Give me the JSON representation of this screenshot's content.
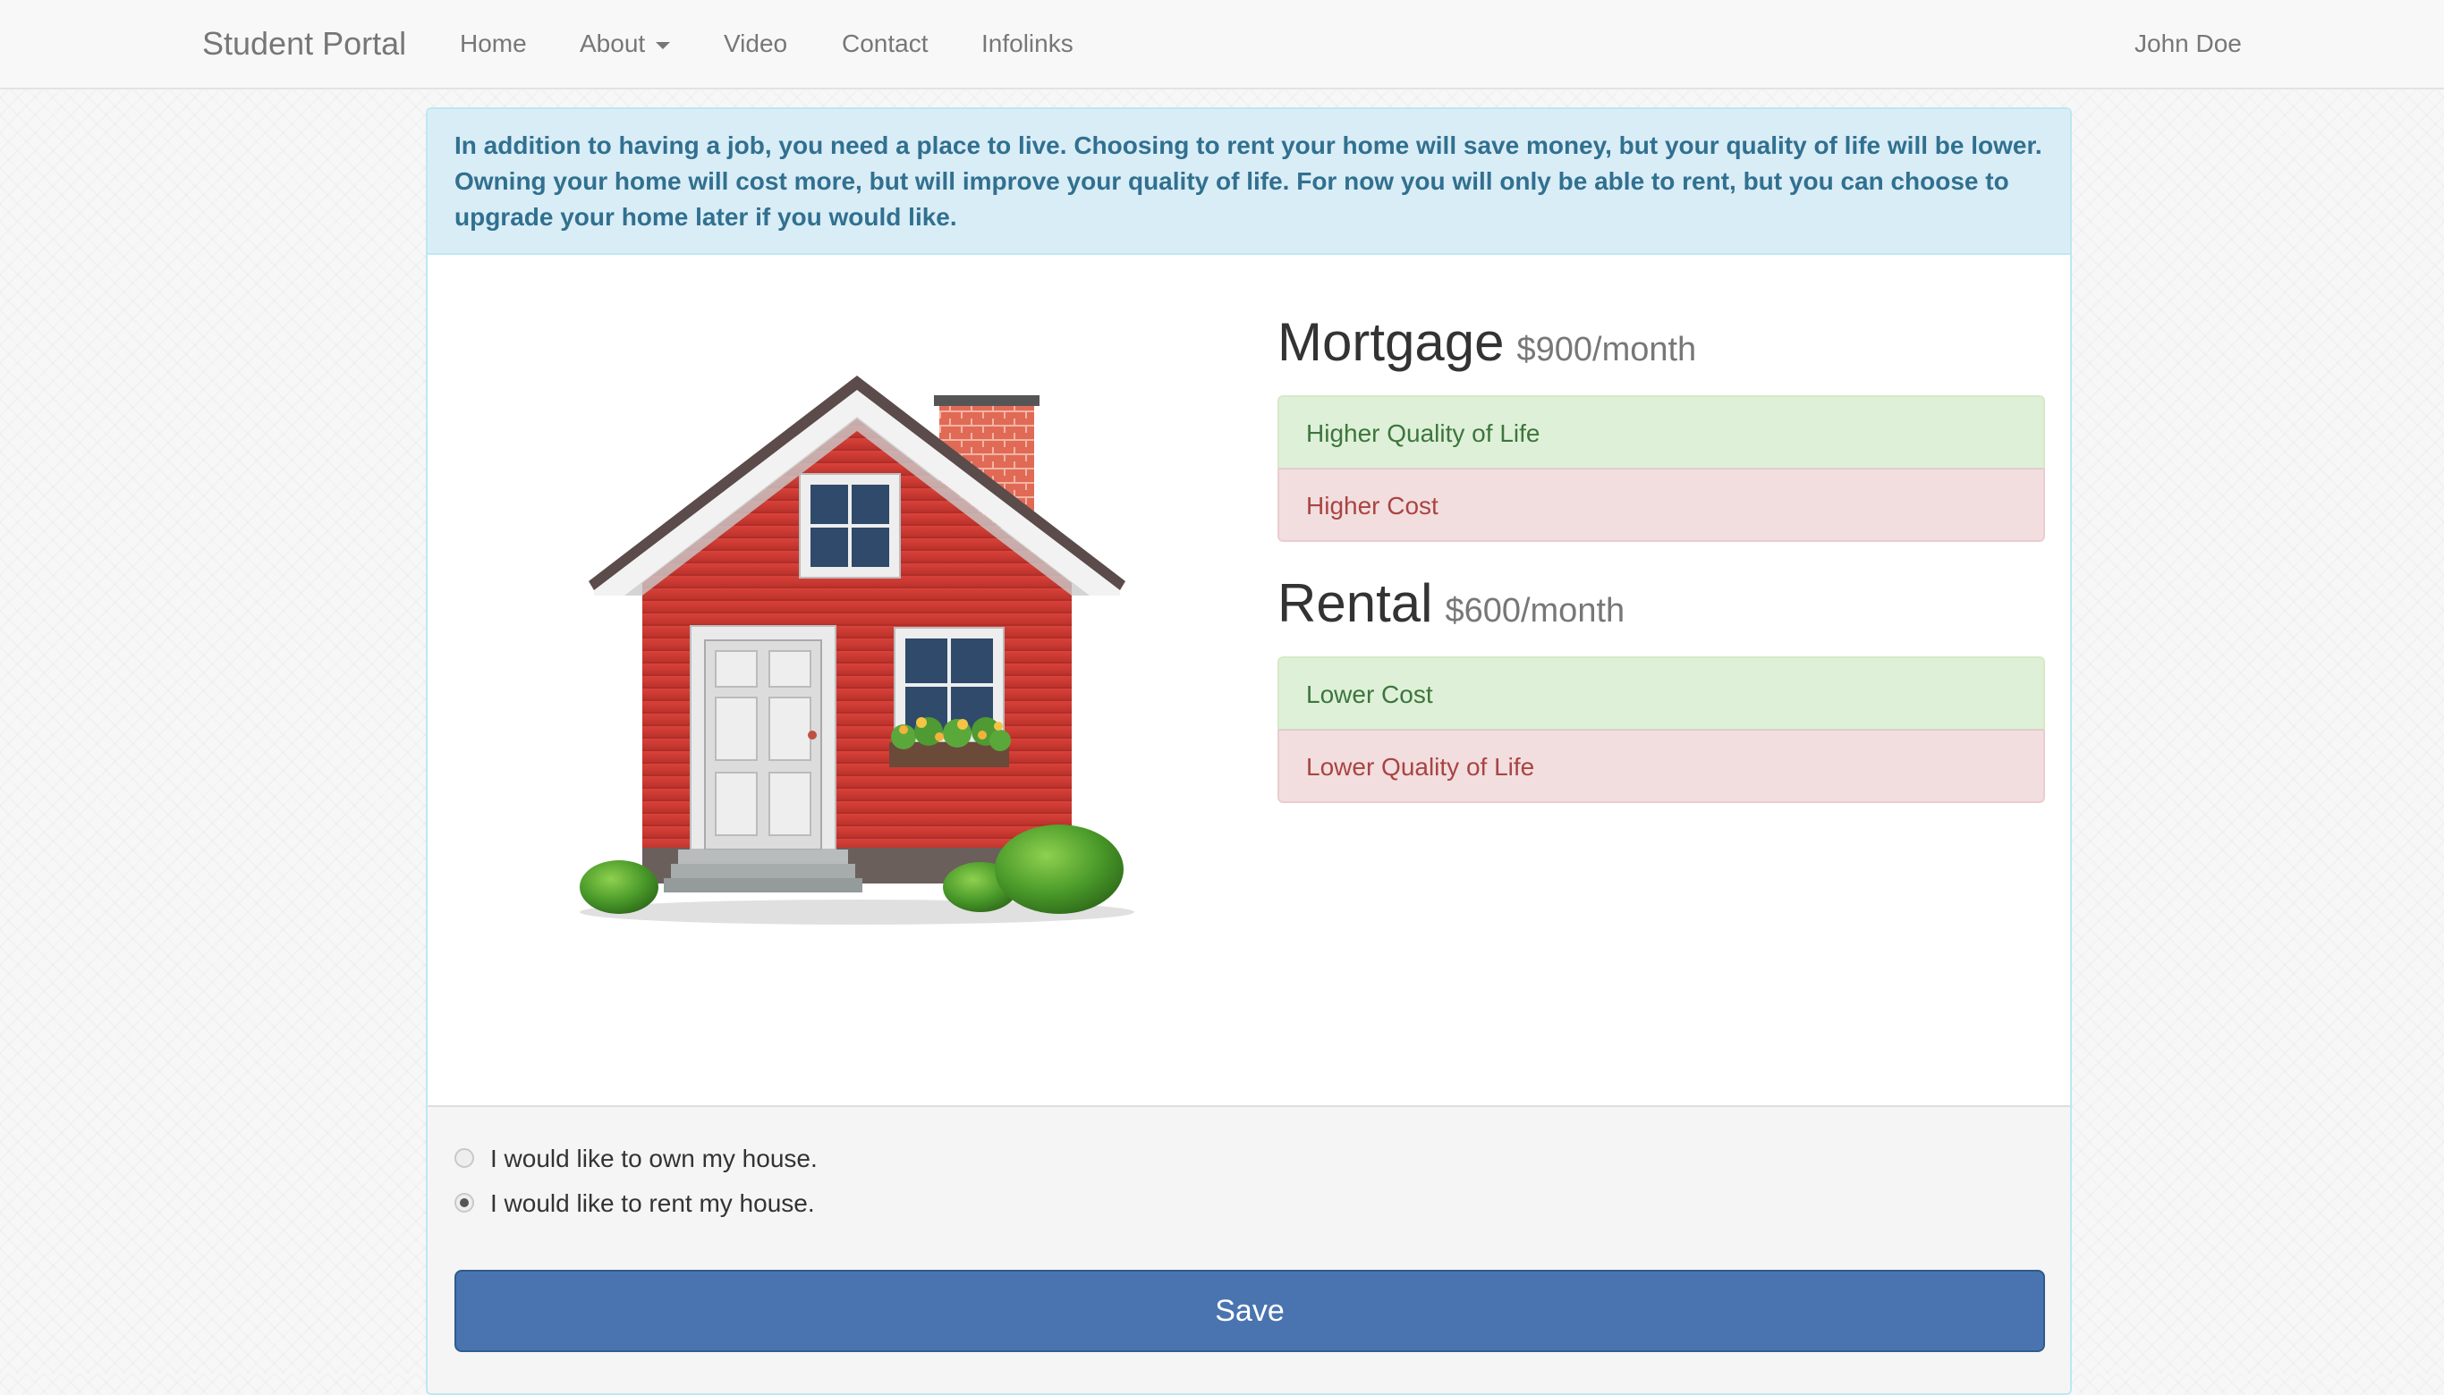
{
  "navbar": {
    "brand": "Student Portal",
    "links": [
      "Home",
      "About",
      "Video",
      "Contact",
      "Infolinks"
    ],
    "user": "John Doe"
  },
  "intro": "In addition to having a job, you need a place to live. Choosing to rent your home will save money, but your quality of life will be lower. Owning your home will cost more, but will improve your quality of life. For now you will only be able to rent, but you can choose to upgrade your home later if you would like.",
  "mortgage": {
    "title": "Mortgage",
    "price": "$900/month",
    "pro": "Higher Quality of Life",
    "con": "Higher Cost"
  },
  "rental": {
    "title": "Rental",
    "price": "$600/month",
    "pro": "Lower Cost",
    "con": "Lower Quality of Life"
  },
  "choices": {
    "own": "I would like to own my house.",
    "rent": "I would like to rent my house.",
    "selected": "rent"
  },
  "save_label": "Save",
  "icons": [
    "house-illustration"
  ],
  "colors": {
    "heading_bg": "#d9edf7",
    "success_bg": "#dff0d8",
    "danger_bg": "#f2dede",
    "button": "#4a74b0"
  }
}
